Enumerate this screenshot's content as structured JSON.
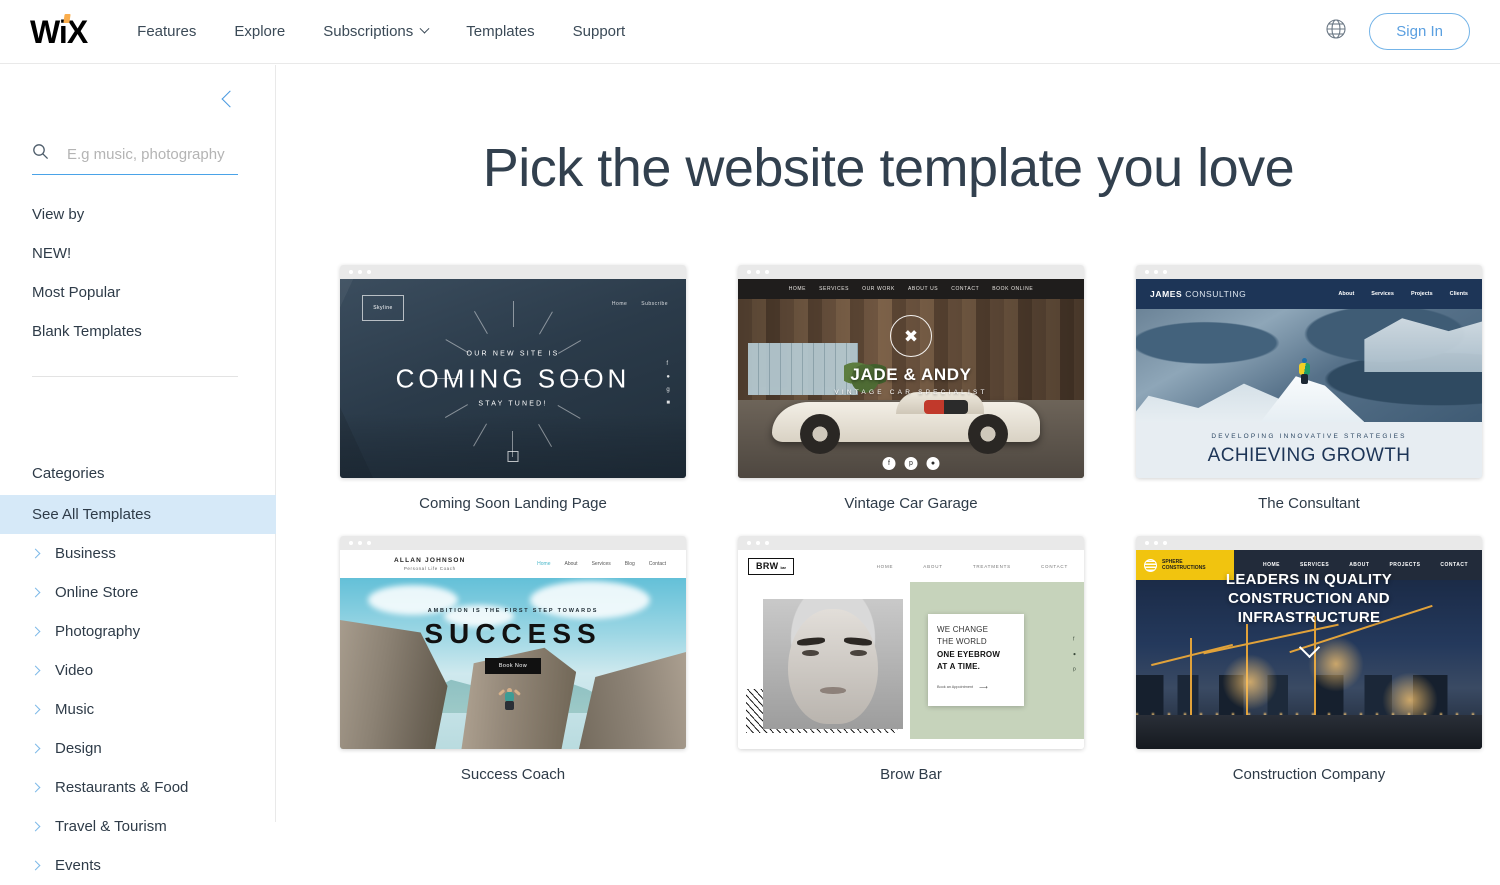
{
  "header": {
    "logo_text": "WiX",
    "nav_items": [
      {
        "label": "Features",
        "has_caret": false
      },
      {
        "label": "Explore",
        "has_caret": false
      },
      {
        "label": "Subscriptions",
        "has_caret": true
      },
      {
        "label": "Templates",
        "has_caret": false
      },
      {
        "label": "Support",
        "has_caret": false
      }
    ],
    "globe_icon": "globe-icon",
    "signin_label": "Sign In",
    "accent_blue": "#74b4e8"
  },
  "sidebar": {
    "collapse_icon": "chevron-left-icon",
    "search": {
      "icon": "search-icon",
      "placeholder": "E.g music, photography",
      "value": ""
    },
    "view_by": [
      {
        "label": "View by",
        "type": "heading"
      },
      {
        "label": "NEW!",
        "type": "item"
      },
      {
        "label": "Most Popular",
        "type": "item"
      },
      {
        "label": "Blank Templates",
        "type": "item"
      }
    ],
    "categories_heading": "Categories",
    "categories": [
      {
        "label": "See All Templates",
        "active": true,
        "chevron": false
      },
      {
        "label": "Business",
        "active": false,
        "chevron": true
      },
      {
        "label": "Online Store",
        "active": false,
        "chevron": true
      },
      {
        "label": "Photography",
        "active": false,
        "chevron": true
      },
      {
        "label": "Video",
        "active": false,
        "chevron": true
      },
      {
        "label": "Music",
        "active": false,
        "chevron": true
      },
      {
        "label": "Design",
        "active": false,
        "chevron": true
      },
      {
        "label": "Restaurants & Food",
        "active": false,
        "chevron": true
      },
      {
        "label": "Travel & Tourism",
        "active": false,
        "chevron": true
      },
      {
        "label": "Events",
        "active": false,
        "chevron": true
      }
    ],
    "active_highlight_color": "#d6e9f8"
  },
  "main": {
    "title": "Pick the website template you love",
    "templates": [
      {
        "caption": "Coming Soon Landing Page",
        "preview": {
          "brand": "Skyline",
          "nav": [
            "Home",
            "Subscribe"
          ],
          "pre_headline": "OUR NEW SITE IS",
          "headline": "COMING SOON",
          "sub_headline": "STAY TUNED!",
          "social_icons": [
            "facebook-icon",
            "twitter-icon",
            "google-plus-icon",
            "instagram-icon"
          ],
          "background_color": "#2b3b4a"
        }
      },
      {
        "caption": "Vintage Car Garage",
        "preview": {
          "nav": [
            "HOME",
            "SERVICES",
            "OUR WORK",
            "ABOUT US",
            "CONTACT",
            "BOOK ONLINE"
          ],
          "emblem_icon": "crossed-wrenches-icon",
          "headline": "JADE & ANDY",
          "sub_headline": "VINTAGE CAR SPECIALIST",
          "social_icons": [
            "facebook-icon",
            "pinterest-icon",
            "instagram-icon"
          ],
          "background_color": "#3a2a20"
        }
      },
      {
        "caption": "The Consultant",
        "preview": {
          "brand_bold": "JAMES",
          "brand_light": "CONSULTING",
          "nav": [
            "About",
            "Services",
            "Projects",
            "Clients"
          ],
          "pre_headline": "DEVELOPING INNOVATIVE STRATEGIES",
          "headline": "ACHIEVING GROWTH",
          "nav_color": "#1d3557"
        }
      },
      {
        "caption": "Success Coach",
        "preview": {
          "brand": "ALLAN JOHNSON",
          "brand_sub": "Personal Life Coach",
          "nav": [
            "Home",
            "About",
            "Services",
            "Blog",
            "Contact"
          ],
          "pre_headline": "AMBITION IS THE FIRST STEP TOWARDS",
          "headline": "SUCCESS",
          "button_label": "Book Now"
        }
      },
      {
        "caption": "Brow Bar",
        "preview": {
          "logo": "BRW",
          "logo_sup": "bar",
          "nav": [
            "HOME",
            "ABOUT",
            "TREATMENTS",
            "CONTACT"
          ],
          "quote_lines": [
            "WE CHANGE",
            "THE WORLD",
            "ONE EYEBROW",
            "AT A TIME."
          ],
          "cta_label": "Book an Appointment",
          "cta_icon": "arrow-right-icon",
          "social_icons": [
            "facebook-icon",
            "instagram-icon",
            "pinterest-icon"
          ],
          "accent_color": "#c6d3bb"
        }
      },
      {
        "caption": "Construction Company",
        "preview": {
          "brand_line1": "SPHERE",
          "brand_line2": "CONSTRUCTIONS",
          "nav": [
            "HOME",
            "SERVICES",
            "ABOUT",
            "PROJECTS",
            "CONTACT"
          ],
          "headline_lines": [
            "LEADERS IN QUALITY",
            "CONSTRUCTION AND",
            "INFRASTRUCTURE"
          ],
          "scroll_icon": "chevron-down-icon",
          "badge_color": "#f1c40f"
        }
      }
    ]
  }
}
